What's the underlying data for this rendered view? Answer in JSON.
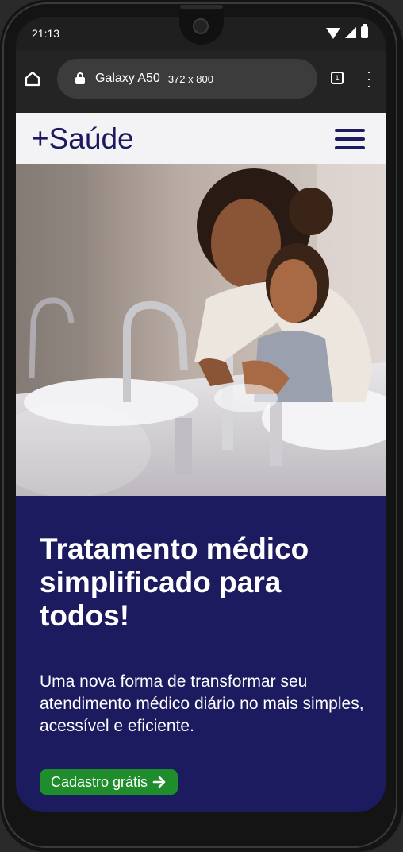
{
  "statusbar": {
    "time": "21:13"
  },
  "browser": {
    "device_name": "Galaxy A50",
    "device_size": "372 x 800",
    "tab_count": "1"
  },
  "site": {
    "logo": "+Saúde",
    "hero": {
      "title": "Tratamento médico simplificado para todos!",
      "text": "Uma nova forma de transformar seu atendimento médico diário no mais simples, acessível e eficiente.",
      "cta": "Cadastro grátis",
      "cta_icon": "arrow-right-icon"
    }
  },
  "colors": {
    "brand_navy": "#1d1b5f",
    "header_bg": "#f3f3f6",
    "cta_green": "#1f8d2c"
  }
}
